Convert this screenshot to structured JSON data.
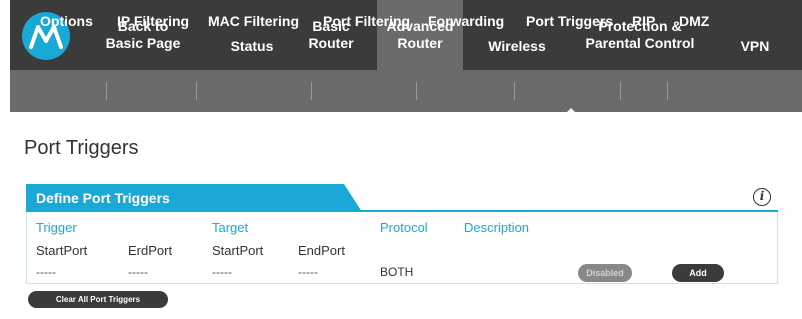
{
  "top_nav": {
    "logo": "motorola-logo",
    "items": [
      {
        "label": "Back to\nBasic Page"
      },
      {
        "label": "Status"
      },
      {
        "label": "Basic\nRouter"
      },
      {
        "label": "Advanced\nRouter"
      },
      {
        "label": "Wireless"
      },
      {
        "label": "Protection &\nParental Control"
      },
      {
        "label": "VPN"
      }
    ]
  },
  "sub_nav": {
    "items": [
      {
        "label": "Options"
      },
      {
        "label": "IP Filtering"
      },
      {
        "label": "MAC Filtering"
      },
      {
        "label": "Port Filtering"
      },
      {
        "label": "Forwarding"
      },
      {
        "label": "Port Triggers"
      },
      {
        "label": "RIP"
      },
      {
        "label": "DMZ"
      }
    ]
  },
  "page": {
    "title": "Port Triggers",
    "section_title": "Define Port Triggers",
    "info_icon": "i",
    "columns": {
      "trigger": "Trigger",
      "target": "Target",
      "protocol": "Protocol",
      "description": "Description"
    },
    "sub_columns": {
      "trigger_start": "StartPort",
      "trigger_end": "ErdPort",
      "target_start": "StartPort",
      "target_end": "EndPort"
    },
    "row": {
      "trigger_start": "-----",
      "trigger_end": "-----",
      "target_start": "-----",
      "target_end": "-----",
      "protocol": "BOTH",
      "status_button": "Disabled",
      "add_button": "Add"
    },
    "clear_button": "Clear All Port Triggers"
  },
  "colors": {
    "nav_dark": "#3b3b3b",
    "nav_active": "#6b6b6b",
    "accent": "#1aa8d6"
  }
}
